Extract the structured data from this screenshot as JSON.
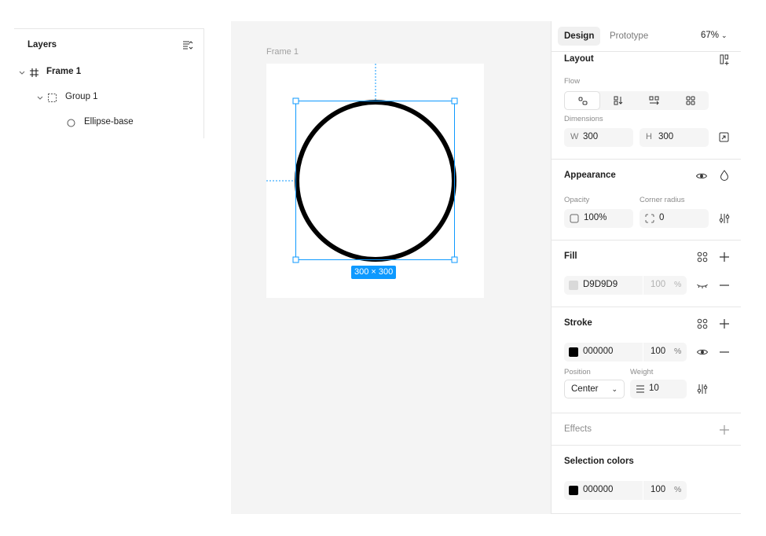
{
  "layers": {
    "title": "Layers",
    "items": [
      {
        "name": "Frame 1"
      },
      {
        "name": "Group 1"
      },
      {
        "name": "Ellipse-base"
      }
    ]
  },
  "canvas": {
    "frame_label": "Frame 1",
    "size_badge": "300 × 300",
    "selection_color": "#0d99ff",
    "stroke_color": "#000000"
  },
  "panel": {
    "tabs": {
      "design": "Design",
      "prototype": "Prototype"
    },
    "zoom": "67%",
    "layout": {
      "title": "Layout",
      "flow_label": "Flow",
      "dimensions_label": "Dimensions",
      "w_prefix": "W",
      "w_value": "300",
      "h_prefix": "H",
      "h_value": "300"
    },
    "appearance": {
      "title": "Appearance",
      "opacity_label": "Opacity",
      "opacity_value": "100%",
      "radius_label": "Corner radius",
      "radius_value": "0"
    },
    "fill": {
      "title": "Fill",
      "hex": "D9D9D9",
      "swatch": "#d9d9d9",
      "opacity": "100",
      "unit": "%"
    },
    "stroke": {
      "title": "Stroke",
      "hex": "000000",
      "swatch": "#000000",
      "opacity": "100",
      "unit": "%",
      "position_label": "Position",
      "position_value": "Center",
      "weight_label": "Weight",
      "weight_value": "10"
    },
    "effects": {
      "title": "Effects"
    },
    "selection_colors": {
      "title": "Selection colors",
      "hex": "000000",
      "swatch": "#000000",
      "opacity": "100",
      "unit": "%"
    }
  }
}
